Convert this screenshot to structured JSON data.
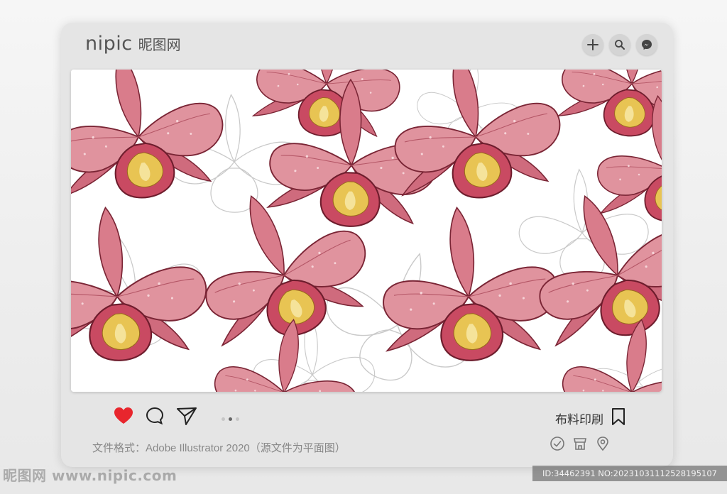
{
  "brand": {
    "logo": "nipic",
    "name_cn": "昵图网"
  },
  "top_icons": [
    "plus-icon",
    "search-icon",
    "messenger-icon"
  ],
  "pagination": {
    "total": 3,
    "active_index": 1
  },
  "actions": {
    "fabric_label": "布料印刷"
  },
  "format_text": "文件格式：Adobe Illustrator 2020（源文件为平面图）",
  "info_icons": [
    "check-circle-icon",
    "shop-icon",
    "location-pin-icon"
  ],
  "watermark": {
    "left": "昵图网 www.nipic.com",
    "right": "ID:34462391 NO:20231031112528195107"
  },
  "colors": {
    "petal": "#d9838f",
    "petal_dark": "#8e2f3f",
    "lip_yellow": "#e8c453",
    "like_red": "#e8262d",
    "card_bg": "#e5e5e5"
  }
}
